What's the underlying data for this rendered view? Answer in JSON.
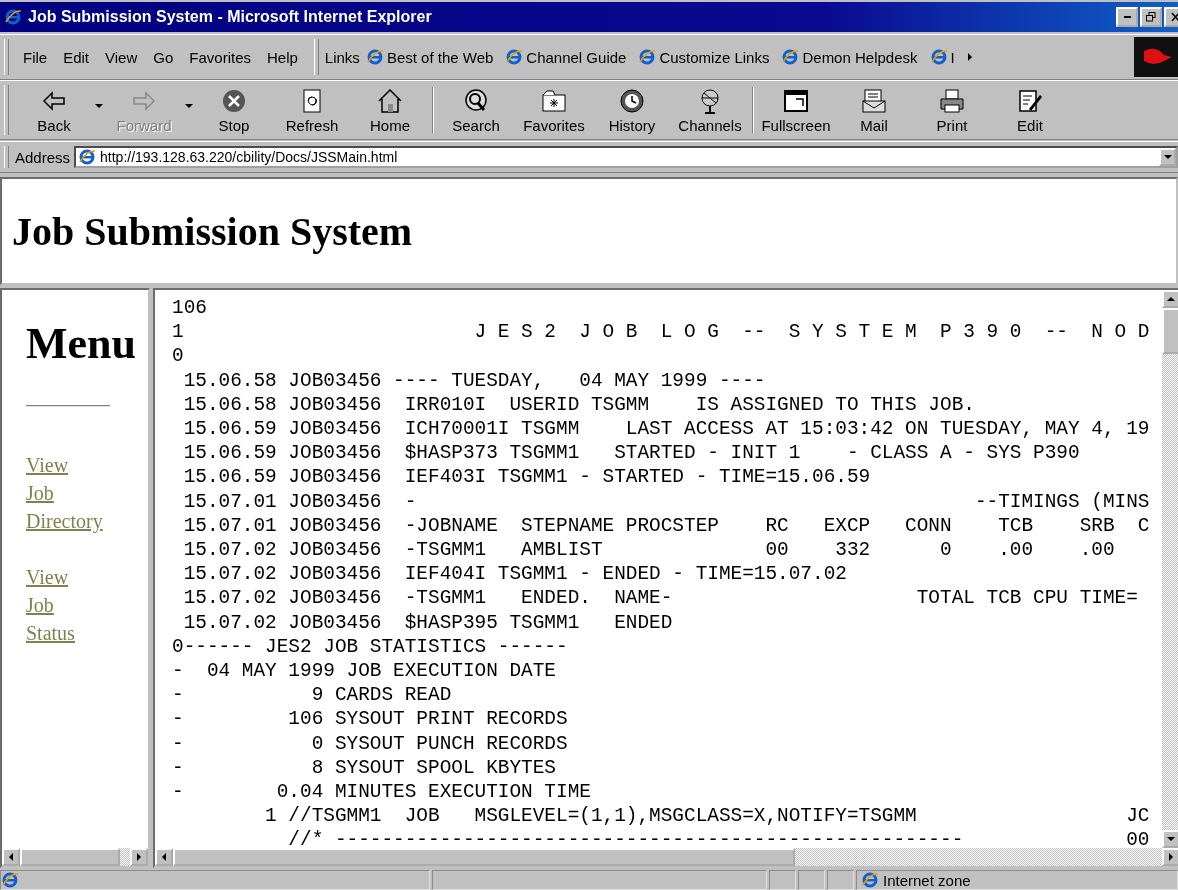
{
  "window": {
    "title": "Job Submission System - Microsoft Internet Explorer"
  },
  "menu_bar": [
    "File",
    "Edit",
    "View",
    "Go",
    "Favorites",
    "Help"
  ],
  "links": {
    "label": "Links",
    "items": [
      "Best of the Web",
      "Channel Guide",
      "Customize Links",
      "Demon Helpdesk",
      "I"
    ]
  },
  "toolbar": [
    {
      "label": "Back",
      "dropdown": true,
      "disabled": false
    },
    {
      "label": "Forward",
      "dropdown": true,
      "disabled": true
    },
    {
      "label": "Stop",
      "dropdown": false,
      "disabled": false
    },
    {
      "label": "Refresh",
      "dropdown": false,
      "disabled": false
    },
    {
      "label": "Home",
      "dropdown": false,
      "disabled": false
    },
    {
      "label": "Search",
      "dropdown": false,
      "disabled": false
    },
    {
      "label": "Favorites",
      "dropdown": false,
      "disabled": false
    },
    {
      "label": "History",
      "dropdown": false,
      "disabled": false
    },
    {
      "label": "Channels",
      "dropdown": false,
      "disabled": false
    },
    {
      "label": "Fullscreen",
      "dropdown": false,
      "disabled": false
    },
    {
      "label": "Mail",
      "dropdown": false,
      "disabled": false
    },
    {
      "label": "Print",
      "dropdown": false,
      "disabled": false
    },
    {
      "label": "Edit",
      "dropdown": false,
      "disabled": false
    }
  ],
  "address": {
    "label": "Address",
    "value": "http://193.128.63.220/cbility/Docs/JSSMain.html"
  },
  "page": {
    "heading": "Job Submission System",
    "menu": {
      "heading": "Menu",
      "links": [
        "View Job Directory",
        "View Job Status"
      ]
    },
    "log_lines": [
      "106",
      "1                         J E S 2  J O B  L O G  --  S Y S T E M  P 3 9 0  --  N O D",
      "0",
      " 15.06.58 JOB03456 ---- TUESDAY,   04 MAY 1999 ----",
      " 15.06.58 JOB03456  IRR010I  USERID TSGMM    IS ASSIGNED TO THIS JOB.",
      " 15.06.59 JOB03456  ICH70001I TSGMM    LAST ACCESS AT 15:03:42 ON TUESDAY, MAY 4, 19",
      " 15.06.59 JOB03456  $HASP373 TSGMM1   STARTED - INIT 1    - CLASS A - SYS P390",
      " 15.06.59 JOB03456  IEF403I TSGMM1 - STARTED - TIME=15.06.59",
      " 15.07.01 JOB03456  -                                                --TIMINGS (MINS",
      " 15.07.01 JOB03456  -JOBNAME  STEPNAME PROCSTEP    RC   EXCP   CONN    TCB    SRB  C",
      " 15.07.02 JOB03456  -TSGMM1   AMBLIST              00    332      0    .00    .00",
      " 15.07.02 JOB03456  IEF404I TSGMM1 - ENDED - TIME=15.07.02",
      " 15.07.02 JOB03456  -TSGMM1   ENDED.  NAME-                     TOTAL TCB CPU TIME=",
      " 15.07.02 JOB03456  $HASP395 TSGMM1   ENDED",
      "0------ JES2 JOB STATISTICS ------",
      "-  04 MAY 1999 JOB EXECUTION DATE",
      "-           9 CARDS READ",
      "-         106 SYSOUT PRINT RECORDS",
      "-           0 SYSOUT PUNCH RECORDS",
      "-           8 SYSOUT SPOOL KBYTES",
      "-        0.04 MINUTES EXECUTION TIME",
      "        1 //TSGMM1  JOB   MSGLEVEL=(1,1),MSGCLASS=X,NOTIFY=TSGMM                  JC",
      "          //* ------------------------------------------------------              00"
    ]
  },
  "status_bar": {
    "zone": "Internet zone"
  }
}
